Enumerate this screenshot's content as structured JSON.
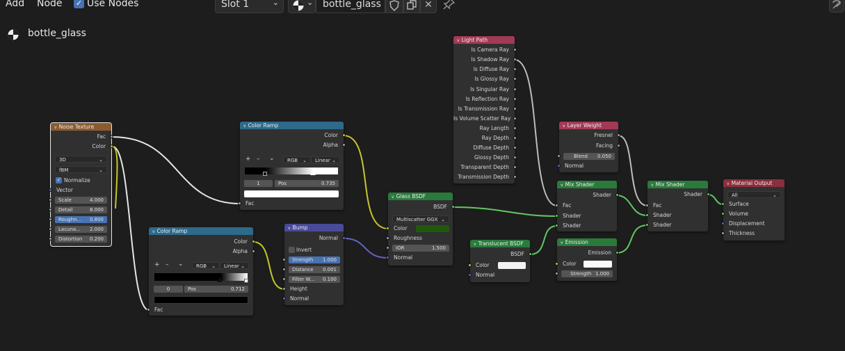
{
  "topbar": {
    "add": "Add",
    "node": "Node",
    "use_nodes": "Use Nodes",
    "slot": "Slot 1",
    "material_name": "bottle_glass",
    "chevron": "⌄"
  },
  "breadcrumb": {
    "material": "bottle_glass"
  },
  "noise": {
    "title": "Noise Texture",
    "fac": "Fac",
    "color": "Color",
    "dim": "3D",
    "type": "fBM",
    "normalize": "Normalize",
    "vector": "Vector",
    "scale_l": "Scale",
    "scale": "4.000",
    "detail_l": "Detail",
    "detail": "8.000",
    "rough_l": "Roughn...",
    "rough": "0.800",
    "lac_l": "Lacuna...",
    "lac": "2.000",
    "dist_l": "Distortion",
    "dist": "0.200"
  },
  "ramp1": {
    "title": "Color Ramp",
    "color": "Color",
    "alpha": "Alpha",
    "plus": "+",
    "minus": "–",
    "mode": "RGB",
    "interp": "Linear",
    "index": "1",
    "pos_l": "Pos",
    "pos": "0.735",
    "fac": "Fac"
  },
  "ramp2": {
    "title": "Color Ramp",
    "color": "Color",
    "alpha": "Alpha",
    "plus": "+",
    "minus": "–",
    "mode": "RGB",
    "interp": "Linear",
    "index": "0",
    "pos_l": "Pos",
    "pos": "0.712",
    "fac": "Fac"
  },
  "bump": {
    "title": "Bump",
    "normal_out": "Normal",
    "invert": "Invert",
    "strength_l": "Strength",
    "strength": "1.000",
    "distance_l": "Distance",
    "distance": "0.001",
    "filter_l": "Filter W...",
    "filter": "0.100",
    "height": "Height",
    "normal": "Normal"
  },
  "glass": {
    "title": "Glass BSDF",
    "bsdf": "BSDF",
    "dist": "Multiscatter GGX",
    "color": "Color",
    "roughness": "Roughness",
    "ior_l": "IOR",
    "ior": "1.500",
    "normal": "Normal",
    "swatch": "#1f5a0c"
  },
  "lightpath": {
    "title": "Light Path",
    "outputs": [
      "Is Camera Ray",
      "Is Shadow Ray",
      "Is Diffuse Ray",
      "Is Glossy Ray",
      "Is Singular Ray",
      "Is Reflection Ray",
      "Is Transmission Ray",
      "Is Volume Scatter Ray",
      "Ray Length",
      "Ray Depth",
      "Diffuse Depth",
      "Glossy Depth",
      "Transparent Depth",
      "Transmission Depth"
    ]
  },
  "translucent": {
    "title": "Translucent BSDF",
    "bsdf": "BSDF",
    "color": "Color",
    "normal": "Normal"
  },
  "layer": {
    "title": "Layer Weight",
    "fresnel": "Fresnel",
    "facing": "Facing",
    "blend_l": "Blend",
    "blend": "0.050",
    "normal": "Normal"
  },
  "mix1": {
    "title": "Mix Shader",
    "shader_out": "Shader",
    "fac": "Fac",
    "shader1": "Shader",
    "shader2": "Shader"
  },
  "mix2": {
    "title": "Mix Shader",
    "shader_out": "Shader",
    "fac": "Fac",
    "shader1": "Shader",
    "shader2": "Shader"
  },
  "emission": {
    "title": "Emission",
    "emission": "Emission",
    "color": "Color",
    "strength_l": "Strength",
    "strength": "1.000"
  },
  "output": {
    "title": "Material Output",
    "target": "All",
    "surface": "Surface",
    "volume": "Volume",
    "displacement": "Displacement",
    "thickness": "Thickness"
  },
  "colors": {
    "accent": "#4772b3",
    "wire_shader": "#63c763",
    "wire_color": "#c7c729",
    "wire_float": "#a1a1a1",
    "wire_vector": "#6363c7"
  }
}
